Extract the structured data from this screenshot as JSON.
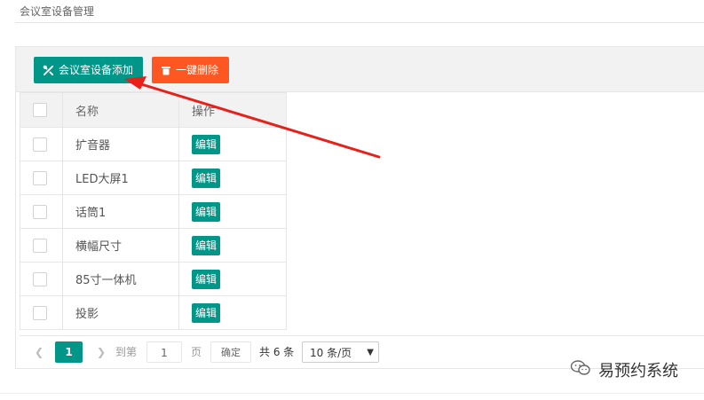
{
  "breadcrumb": "会议室设备管理",
  "toolbar": {
    "add_label": "会议室设备添加",
    "delete_label": "一键删除"
  },
  "table": {
    "headers": {
      "name": "名称",
      "operation": "操作"
    },
    "rows": [
      {
        "name": "扩音器",
        "action": "编辑"
      },
      {
        "name": "LED大屏1",
        "action": "编辑"
      },
      {
        "name": "话筒1",
        "action": "编辑"
      },
      {
        "name": "横幅尺寸",
        "action": "编辑"
      },
      {
        "name": "85寸一体机",
        "action": "编辑"
      },
      {
        "name": "投影",
        "action": "编辑"
      }
    ]
  },
  "pagination": {
    "current_page": "1",
    "goto_label": "到第",
    "goto_value": "1",
    "page_label": "页",
    "confirm_label": "确定",
    "total_label": "共 6 条",
    "page_size": "10 条/页"
  },
  "watermark": "易预约系统",
  "colors": {
    "primary": "#009688",
    "danger": "#ff5722",
    "annotation_arrow": "#e8201a"
  }
}
